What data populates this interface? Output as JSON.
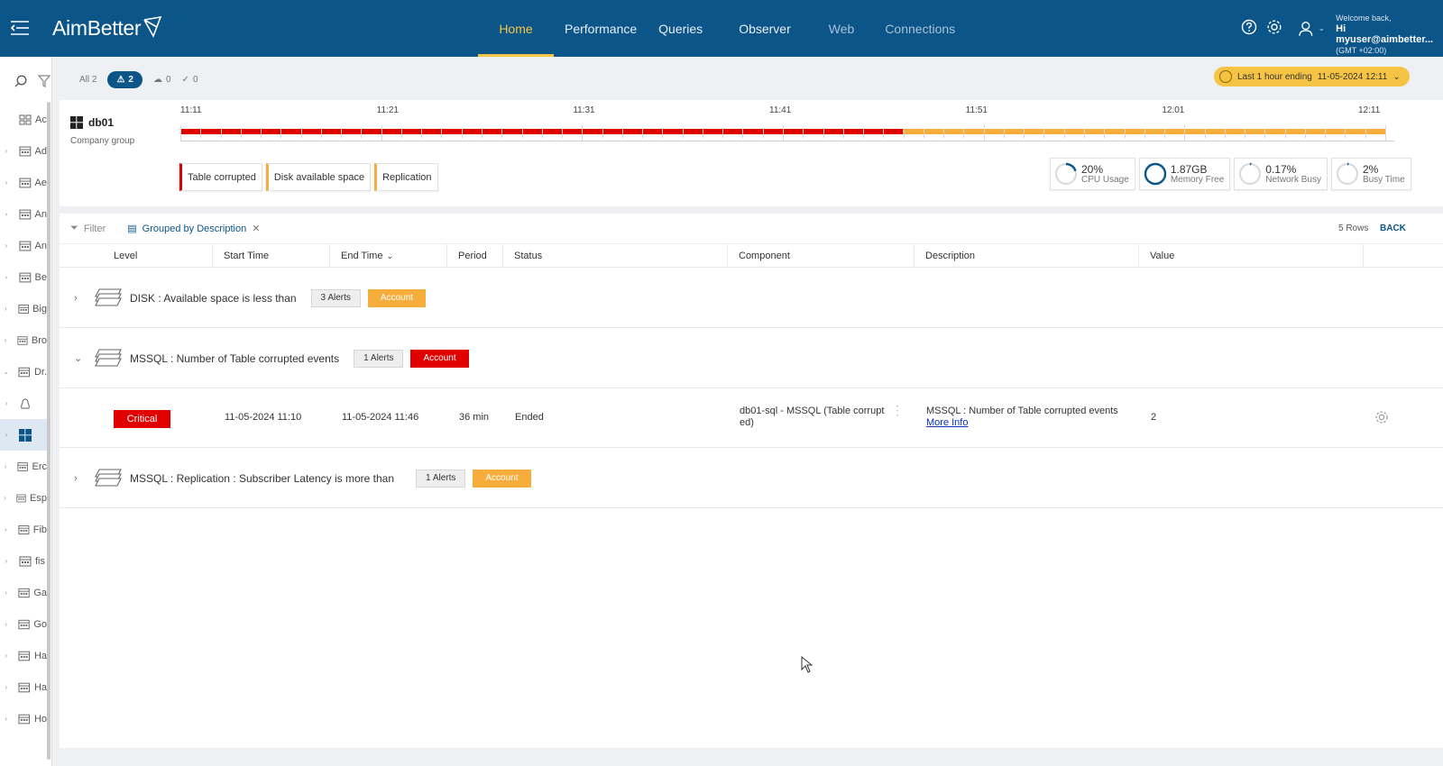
{
  "header": {
    "brand": "AimBetter",
    "tabs": [
      {
        "label": "Home",
        "active": true
      },
      {
        "label": "Performance"
      },
      {
        "label": "Queries"
      },
      {
        "label": "Observer"
      },
      {
        "label": "Web"
      },
      {
        "label": "Connections"
      }
    ],
    "user": {
      "welcome": "Welcome back,",
      "greeting": "Hi myuser@aimbetter...",
      "timezone": "(GMT +02:00)"
    }
  },
  "sidebar": {
    "items": [
      {
        "label": "Ac",
        "icon": "grid-icon"
      },
      {
        "label": "Ad",
        "icon": "building-icon"
      },
      {
        "label": "Ae",
        "icon": "building-icon"
      },
      {
        "label": "An",
        "icon": "building-icon"
      },
      {
        "label": "An",
        "icon": "building-icon"
      },
      {
        "label": "Be",
        "icon": "building-icon"
      },
      {
        "label": "Big",
        "icon": "building-icon"
      },
      {
        "label": "Bro",
        "icon": "building-icon"
      },
      {
        "label": "Dr.",
        "icon": "building-icon"
      },
      {
        "label": "",
        "icon": "linux-icon"
      },
      {
        "label": "",
        "icon": "windows-icon",
        "selected": true
      },
      {
        "label": "Erc",
        "icon": "building-icon"
      },
      {
        "label": "Esp",
        "icon": "building-icon"
      },
      {
        "label": "Fib",
        "icon": "building-icon"
      },
      {
        "label": "fis",
        "icon": "building-icon"
      },
      {
        "label": "Ga",
        "icon": "building-icon"
      },
      {
        "label": "Go",
        "icon": "building-icon"
      },
      {
        "label": "Ha",
        "icon": "building-icon"
      },
      {
        "label": "Ha",
        "icon": "building-icon"
      },
      {
        "label": "Ho",
        "icon": "building-icon"
      }
    ]
  },
  "filters": {
    "all": "All 2",
    "alerts": "2",
    "cloud": "0",
    "resolved": "0"
  },
  "time_range": {
    "label": "Last 1 hour ending",
    "value": "11-05-2024 12:11"
  },
  "server": {
    "name": "db01",
    "group": "Company group",
    "timeline_labels": [
      "11:11",
      "11:21",
      "11:31",
      "11:41",
      "11:51",
      "12:01",
      "12:11"
    ],
    "tags": [
      {
        "label": "Table corrupted",
        "color": "#e00000"
      },
      {
        "label": "Disk available space",
        "color": "#f6ad3c"
      },
      {
        "label": "Replication",
        "color": "#f6ad3c"
      }
    ],
    "metrics": [
      {
        "value": "20%",
        "label": "CPU Usage",
        "fraction": 0.2
      },
      {
        "value": "1.87GB",
        "label": "Memory Free",
        "fraction": 1.0
      },
      {
        "value": "0.17%",
        "label": "Network Busy",
        "fraction": 0.0017
      },
      {
        "value": "2%",
        "label": "Busy Time",
        "fraction": 0.02
      }
    ]
  },
  "table": {
    "filter_label": "Filter",
    "grouped_label": "Grouped by Description",
    "rows_count": "5 Rows",
    "back_label": "BACK",
    "columns": [
      "Level",
      "Start Time",
      "End Time",
      "Period",
      "Status",
      "Component",
      "Description",
      "Value"
    ],
    "groups": [
      {
        "title": "DISK : Available space is less than",
        "alerts": "3 Alerts",
        "account": "Account",
        "color": "orange",
        "expanded": false
      },
      {
        "title": "MSSQL : Number of Table corrupted events",
        "alerts": "1 Alerts",
        "account": "Account",
        "color": "red",
        "expanded": true
      },
      {
        "title": "MSSQL : Replication : Subscriber Latency is more than",
        "alerts": "1 Alerts",
        "account": "Account",
        "color": "orange",
        "expanded": false
      }
    ],
    "detail": {
      "level": "Critical",
      "start": "11-05-2024 11:10",
      "end": "11-05-2024 11:46",
      "period": "36 min",
      "status": "Ended",
      "component": "db01-sql - MSSQL (Table corrupted)",
      "description": "MSSQL : Number of Table corrupted events",
      "more_info": "More Info",
      "value": "2"
    }
  }
}
